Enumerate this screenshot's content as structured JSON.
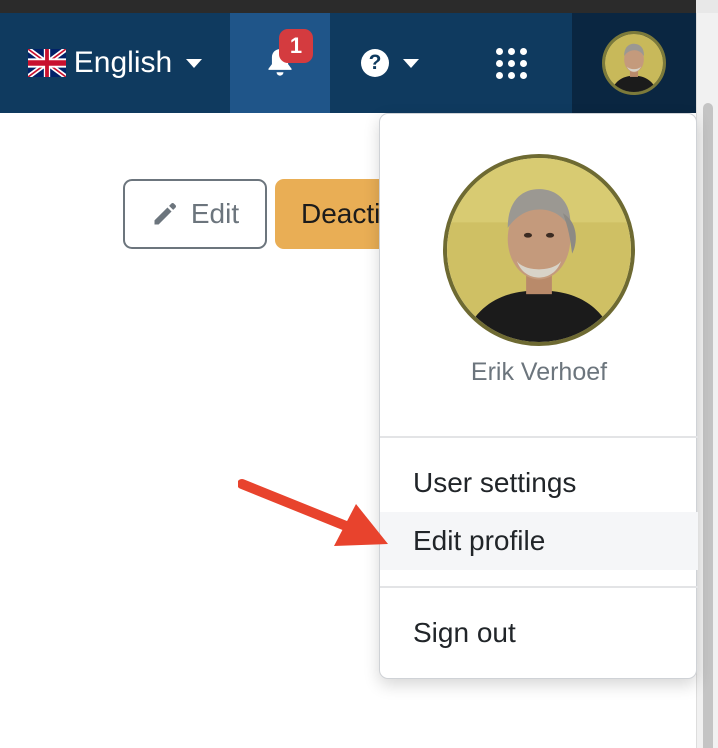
{
  "navbar": {
    "language": {
      "label": "English",
      "flag_icon": "uk-flag-icon"
    },
    "notifications": {
      "count": "1",
      "icon": "bell-icon"
    },
    "help": {
      "icon": "question-circle-icon"
    },
    "apps": {
      "icon": "grid-icon"
    },
    "user": {
      "icon": "avatar"
    }
  },
  "page": {
    "edit_label": "Edit",
    "deactivate_label": "Deacti"
  },
  "user_menu": {
    "name": "Erik Verhoef",
    "items": [
      {
        "label": "User settings"
      },
      {
        "label": "Edit profile"
      },
      {
        "label": "Sign out"
      }
    ]
  },
  "colors": {
    "navbar": "#0f3a5f",
    "notifications_active": "#1f5589",
    "badge": "#d43b3f",
    "warning_button": "#e9ae55",
    "annotation_arrow": "#e8432d"
  }
}
